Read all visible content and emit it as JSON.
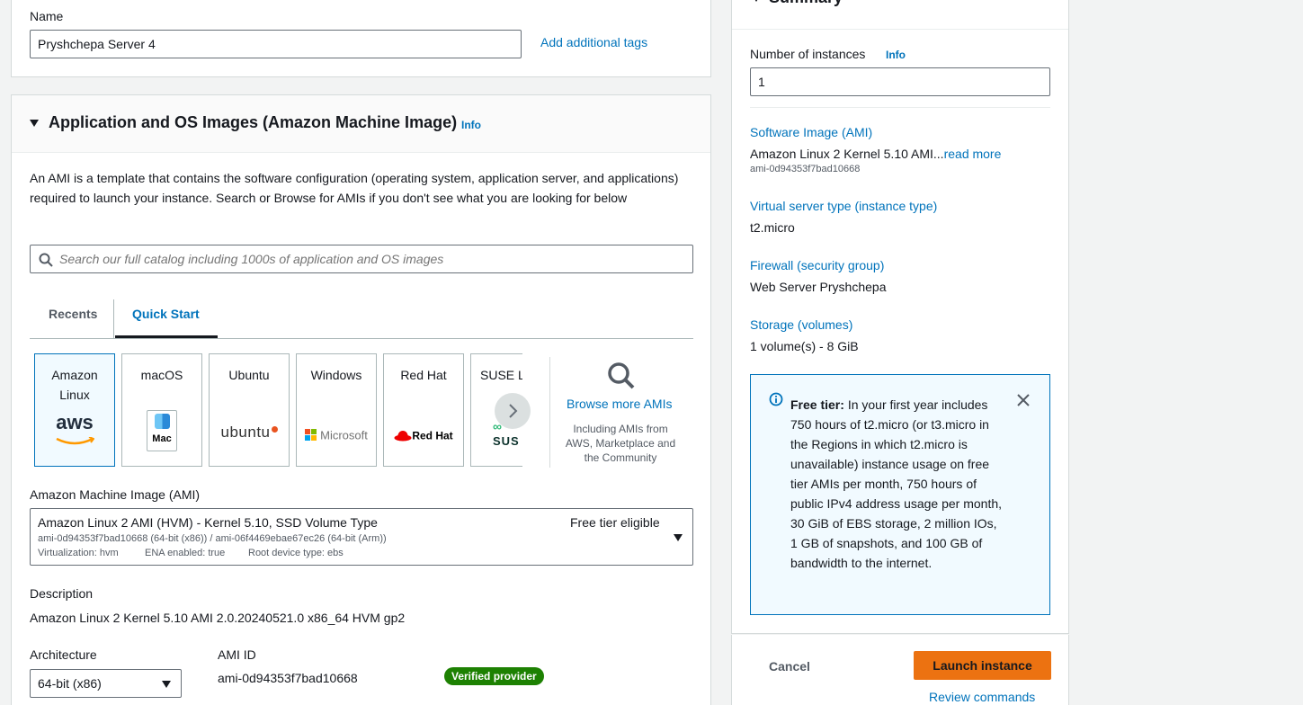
{
  "name_section": {
    "label": "Name",
    "value": "Pryshchepa Server 4",
    "add_tags_link": "Add additional tags"
  },
  "ami_section": {
    "title": "Application and OS Images (Amazon Machine Image)",
    "info": "Info",
    "description": "An AMI is a template that contains the software configuration (operating system, application server, and applications) required to launch your instance. Search or Browse for AMIs if you don't see what you are looking for below",
    "search_placeholder": "Search our full catalog including 1000s of application and OS images",
    "tabs": [
      {
        "label": "Recents"
      },
      {
        "label": "Quick Start"
      }
    ],
    "os_cards": [
      {
        "label": "Amazon Linux",
        "logo": "aws"
      },
      {
        "label": "macOS",
        "logo": "Mac"
      },
      {
        "label": "Ubuntu",
        "logo": "ubuntu"
      },
      {
        "label": "Windows",
        "logo": "Microsoft"
      },
      {
        "label": "Red Hat",
        "logo": "Red Hat"
      },
      {
        "label": "SUSE Li",
        "logo": "SUS"
      }
    ],
    "browse_more": {
      "link": "Browse more AMIs",
      "caption": "Including AMIs from AWS, Marketplace and the Community"
    },
    "ami_select": {
      "label": "Amazon Machine Image (AMI)",
      "name": "Amazon Linux 2 AMI (HVM) - Kernel 5.10, SSD Volume Type",
      "free_tier": "Free tier eligible",
      "ids": "ami-0d94353f7bad10668 (64-bit (x86)) / ami-06f4469ebae67ec26 (64-bit (Arm))",
      "virtualization": "Virtualization: hvm",
      "ena": "ENA enabled: true",
      "root_device": "Root device type: ebs"
    },
    "description_block": {
      "label": "Description",
      "value": "Amazon Linux 2 Kernel 5.10 AMI 2.0.20240521.0 x86_64 HVM gp2"
    },
    "architecture": {
      "label": "Architecture",
      "value": "64-bit (x86)"
    },
    "ami_id": {
      "label": "AMI ID",
      "value": "ami-0d94353f7bad10668",
      "badge": "Verified provider"
    }
  },
  "summary": {
    "title": "Summary",
    "instances_label": "Number of instances",
    "info": "Info",
    "instances_value": "1",
    "software_image_label": "Software Image (AMI)",
    "software_image_value": "Amazon Linux 2 Kernel 5.10 AMI...",
    "read_more": "read more",
    "software_image_id": "ami-0d94353f7bad10668",
    "instance_type_label": "Virtual server type (instance type)",
    "instance_type_value": "t2.micro",
    "firewall_label": "Firewall (security group)",
    "firewall_value": "Web Server Pryshchepa",
    "storage_label": "Storage (volumes)",
    "storage_value": "1 volume(s) - 8 GiB",
    "free_tier_title": "Free tier:",
    "free_tier_text": "In your first year includes 750 hours of t2.micro (or t3.micro in the Regions in which t2.micro is unavailable) instance usage on free tier AMIs per month, 750 hours of public IPv4 address usage per month, 30 GiB of EBS storage, 2 million IOs, 1 GB of snapshots, and 100 GB of bandwidth to the internet.",
    "cancel": "Cancel",
    "launch": "Launch instance",
    "review": "Review commands"
  },
  "colors": {
    "link": "#0073bb",
    "primary_button": "#ec7211",
    "badge_green": "#1d8102",
    "info_bg": "#f1faff"
  }
}
